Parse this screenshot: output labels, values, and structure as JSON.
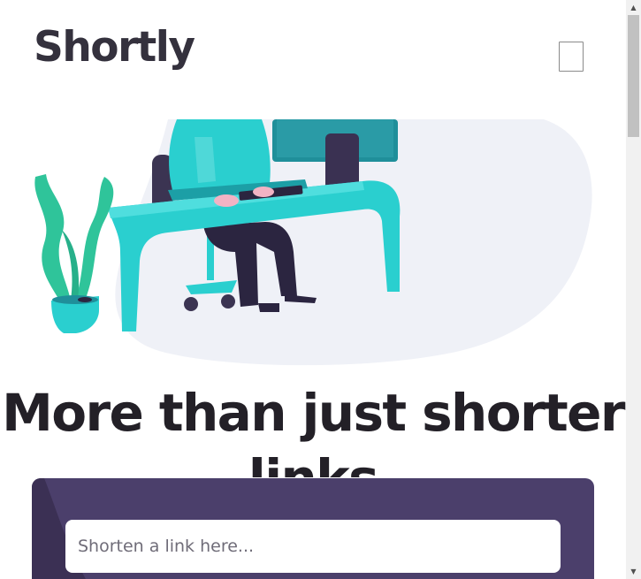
{
  "header": {
    "logo": "Shortly"
  },
  "hero": {
    "headline": "More than just shorter links"
  },
  "shorten": {
    "placeholder": "Shorten a link here..."
  },
  "colors": {
    "logo": "#34313d",
    "headline": "#232027",
    "panel": "#4b3f6b",
    "accent": "#2acfcf"
  },
  "icons": {
    "menu": "hamburger-menu-icon"
  }
}
